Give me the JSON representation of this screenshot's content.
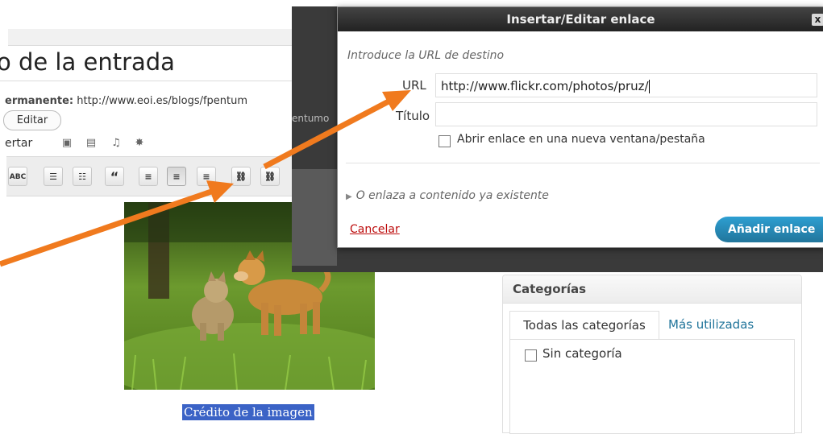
{
  "editor": {
    "post_title": "o de la entrada",
    "permalink_label": "ermanente:",
    "permalink_url": "http://www.eoi.es/blogs/fpentum",
    "permalink_tail": "entumo",
    "edit_button": "Editar",
    "insert_label": "ertar",
    "toolbar": {
      "spellcheck": "ABC",
      "bullets": "☰",
      "numbered": "☷",
      "quote": "“",
      "align_left": "≡",
      "align_center": "≡",
      "align_right": "≡",
      "link": "⛓",
      "unlink": "⛓"
    },
    "image_caption": "Crédito de la imagen"
  },
  "dialog": {
    "title": "Insertar/Editar enlace",
    "close": "x",
    "prompt": "Introduce la URL de destino",
    "url_label": "URL",
    "url_value": "http://www.flickr.com/photos/pruz/",
    "title_label": "Título",
    "title_value": "",
    "open_new_tab_label": "Abrir enlace en una nueva ventana/pestaña",
    "existing_content_toggle": "O enlaza a contenido ya existente",
    "cancel": "Cancelar",
    "submit": "Añadir enlace"
  },
  "categories": {
    "title": "Categorías",
    "tab_all": "Todas las categorías",
    "tab_most_used": "Más utilizadas",
    "items": [
      {
        "label": "Sin categoría",
        "checked": false
      }
    ]
  },
  "colors": {
    "arrow": "#f07a1e",
    "dialog_titlebar": "#333333",
    "primary_button": "#21759b",
    "cancel_link": "#bc0b0b",
    "caption_highlight": "#3b63c6",
    "link": "#21759b"
  },
  "icons": {
    "media_insert": [
      "image-icon",
      "gallery-icon",
      "music-icon",
      "media-icon"
    ]
  }
}
